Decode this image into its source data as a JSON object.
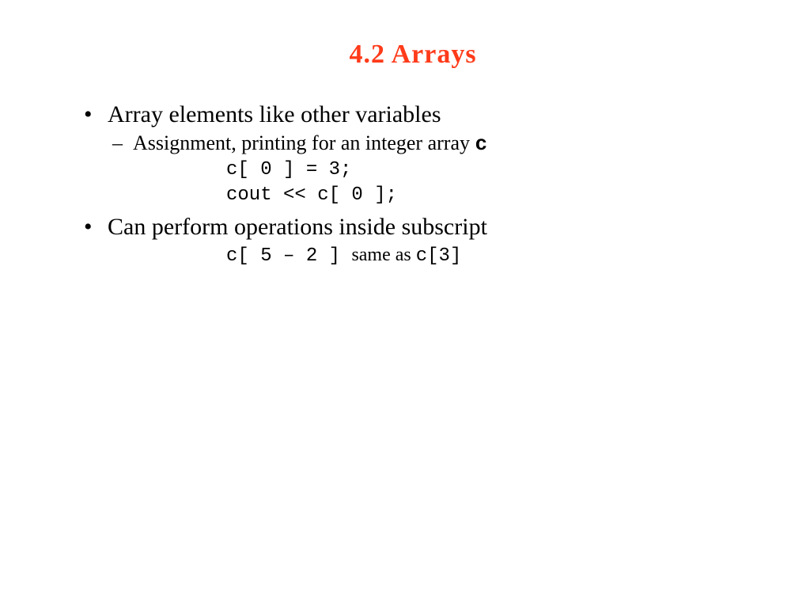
{
  "title": "4.2    Arrays",
  "bullet1": {
    "text_prefix": "Array elements like other variables",
    "sub1_prefix": "Assignment, printing for an integer array ",
    "sub1_code": "c",
    "code_line1": "c[ 0 ] =  3;",
    "code_line2": "cout << c[ 0 ];"
  },
  "bullet2": {
    "text": "Can perform operations inside subscript",
    "code_seg1": "c[ 5 – 2 ] ",
    "mid_text": "same as ",
    "code_seg2": "c[3]"
  }
}
